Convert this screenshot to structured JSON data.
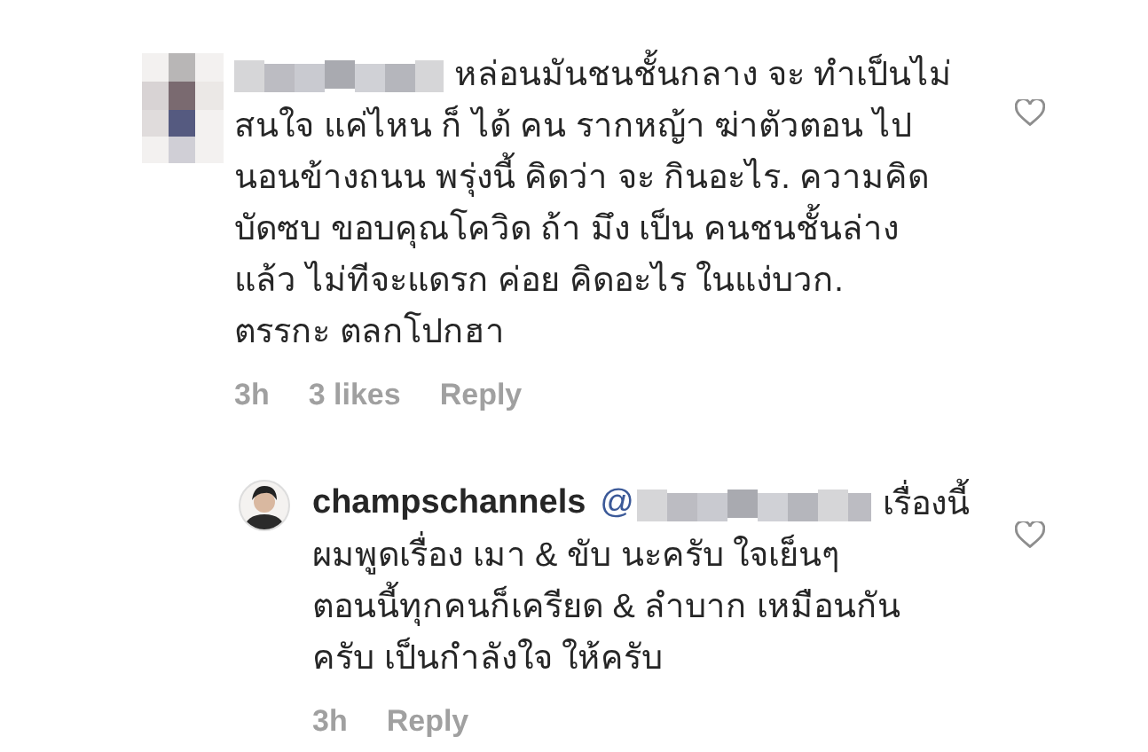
{
  "comments": [
    {
      "kind": "comment",
      "first_line": "หล่อนมันชนชั้นกลาง จะ ทำเป็นไม่",
      "text": "สนใจ แค่ไหน ก็ ได้ คน รากหญ้า ฆ่าตัวตอน ไป\nนอนข้างถนน พรุ่งนี้ คิดว่า จะ กินอะไร. ความคิด\nบัดซบ  ขอบคุณโควิด ถ้า มึง เป็น คนชนชั้นล่าง\nแล้ว ไม่ทีจะแดรก ค่อย คิดอะไร ในแง่บวก.\nตรรกะ ตลกโปกฮา",
      "time": "3h",
      "likes": "3 likes",
      "reply": "Reply",
      "liked": false
    },
    {
      "kind": "reply",
      "username": "champschannels",
      "mention": "@",
      "first_line": "เรื่องนี้",
      "text": "ผมพูดเรื่อง เมา & ขับ นะครับ ใจเย็นๆ\nตอนนี้ทุกคนก็เครียด & ลำบาก เหมือนกัน\nครับ เป็นกำลังใจ ให้ครับ",
      "time": "3h",
      "reply": "Reply",
      "liked": false
    }
  ]
}
